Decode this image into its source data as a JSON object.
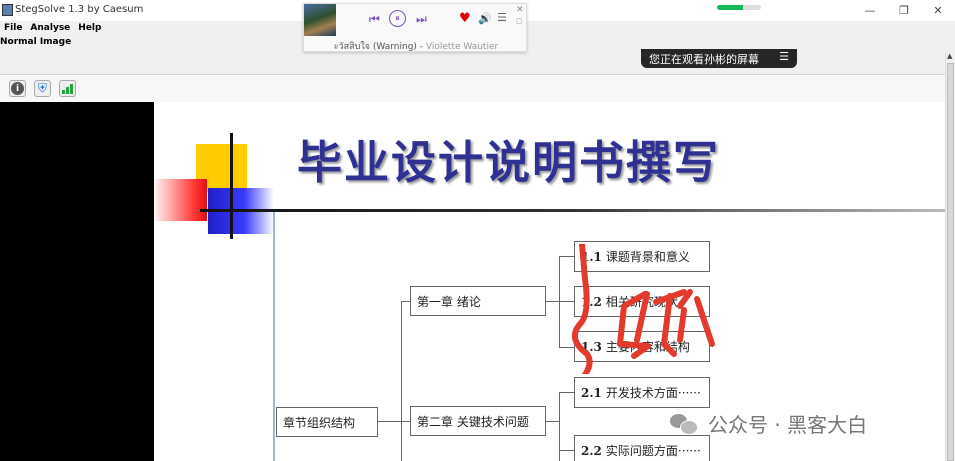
{
  "window": {
    "title": "StegSolve 1.3 by Caesum",
    "controls": {
      "minimize": "—",
      "maximize": "❐",
      "close": "✕"
    },
    "progress_fraction": 0.6
  },
  "menu": {
    "items": [
      "File",
      "Analyse",
      "Help"
    ]
  },
  "image_label": "Normal Image",
  "media_player": {
    "track_title": "ะวัสสิบใจ (Warning)",
    "separator": " - ",
    "artist": "Violette Wautier",
    "controls": {
      "prev": "⏮",
      "pause": "⏸",
      "next": "⏭",
      "like": "♥",
      "volume": "🔊",
      "playlist": "☰",
      "close": "✕",
      "mini": "▢"
    }
  },
  "screen_share": {
    "text": "您正在观看孙彬的屏幕",
    "menu_glyph": "☰"
  },
  "toolbar": {
    "icons": [
      "info-icon",
      "shield-icon",
      "signal-bars-icon"
    ],
    "info_glyph": "i",
    "shield_glyph": "⛨"
  },
  "slide": {
    "title": "毕业设计说明书撰写",
    "root": "章节组织结构",
    "chapters": [
      "第一章 绪论",
      "第二章 关键技术问题"
    ],
    "sections": [
      {
        "num": "1.1",
        "text": "课题背景和意义"
      },
      {
        "num": "1.2",
        "text": "相关研究现状"
      },
      {
        "num": "1.3",
        "text": "主要内容和结构"
      },
      {
        "num": "2.1",
        "text": "开发技术方面······"
      },
      {
        "num": "2.2",
        "text": "实际问题方面······"
      }
    ],
    "annotation": "5分"
  },
  "watermark": {
    "text": "公众号 · 黑客大白"
  },
  "colors": {
    "title": "#2e3192",
    "accent_purple": "#7b53c1",
    "handwriting": "#e33a2e"
  }
}
